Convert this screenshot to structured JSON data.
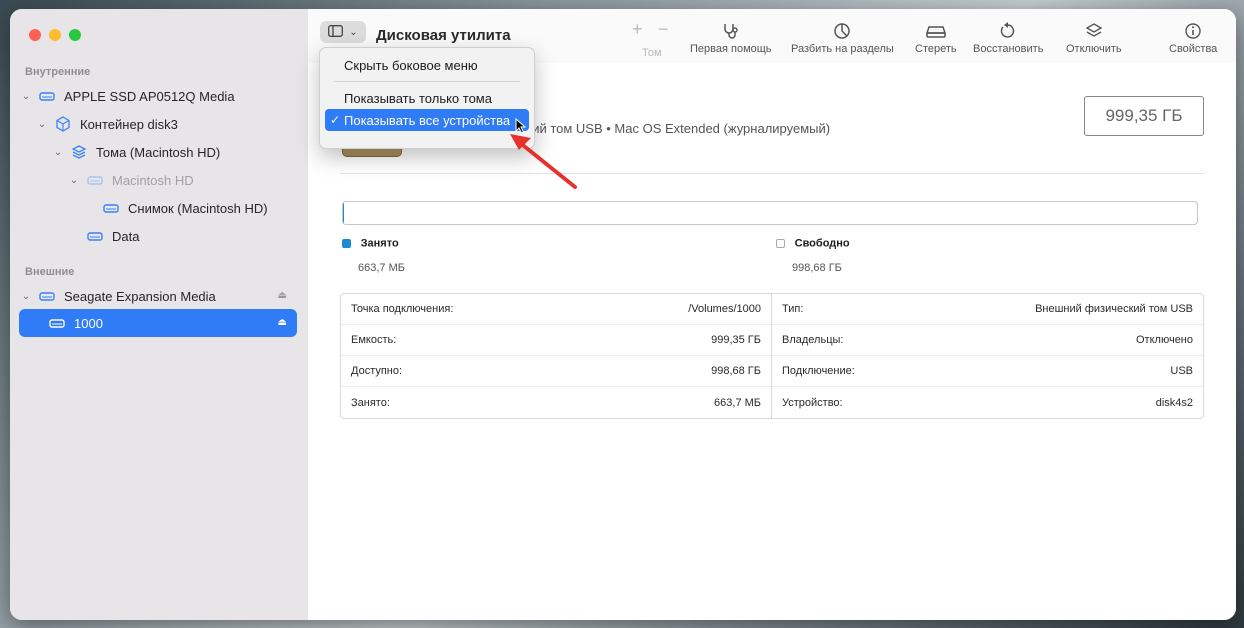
{
  "app": {
    "title": "Дисковая утилита"
  },
  "sidebar": {
    "internal_title": "Внутренние",
    "external_title": "Внешние",
    "items": [
      {
        "label": "APPLE SSD AP0512Q Media"
      },
      {
        "label": "Контейнер disk3"
      },
      {
        "label": "Тома (Macintosh HD)"
      },
      {
        "label": "Macintosh HD"
      },
      {
        "label": "Снимок (Macintosh HD)"
      },
      {
        "label": "Data"
      },
      {
        "label": "Seagate Expansion Media"
      },
      {
        "label": "1000"
      }
    ]
  },
  "toolbar": {
    "plus": "+",
    "minus": "−",
    "volume_label": "Том",
    "first_aid": "Первая помощь",
    "partition": "Разбить на разделы",
    "erase": "Стереть",
    "restore": "Восстановить",
    "unmount": "Отключить",
    "info": "Свойства"
  },
  "menu": {
    "hide_sidebar": "Скрыть боковое меню",
    "show_volumes": "Показывать только тома",
    "show_all": "Показывать все устройства",
    "check": "✓"
  },
  "volume": {
    "subtitle": "ский том USB • Mac OS Extended (журналируемый)",
    "capacity": "999,35 ГБ"
  },
  "usage": {
    "used_label": "Занято",
    "used_value": "663,7 МБ",
    "free_label": "Свободно",
    "free_value": "998,68 ГБ",
    "used_fraction": 0.0007,
    "used_color": "#1f8ad4"
  },
  "info": {
    "left": [
      {
        "key": "Точка подключения:",
        "value": "/Volumes/1000"
      },
      {
        "key": "Емкость:",
        "value": "999,35 ГБ"
      },
      {
        "key": "Доступно:",
        "value": "998,68 ГБ"
      },
      {
        "key": "Занято:",
        "value": "663,7 МБ"
      }
    ],
    "right": [
      {
        "key": "Тип:",
        "value": "Внешний физический том USB"
      },
      {
        "key": "Владельцы:",
        "value": "Отключено"
      },
      {
        "key": "Подключение:",
        "value": "USB"
      },
      {
        "key": "Устройство:",
        "value": "disk4s2"
      }
    ]
  },
  "colors": {
    "accent": "#2f7cf6",
    "annotation_arrow": "#e5322d"
  }
}
